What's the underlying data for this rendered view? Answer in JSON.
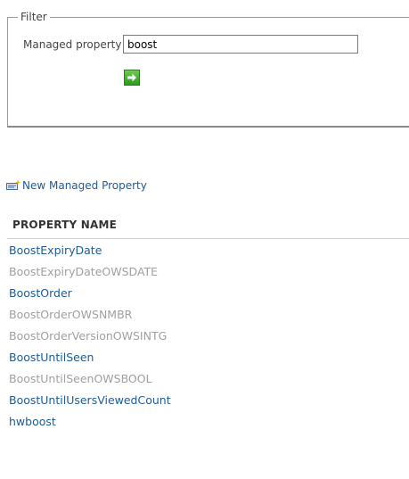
{
  "filter": {
    "legend": "Filter",
    "managed_property_label": "Managed property",
    "search_value": "boost",
    "go_icon": "green-arrow-right-icon"
  },
  "actions": {
    "new_property_label": "New Managed Property",
    "new_property_icon": "new-property-icon"
  },
  "table": {
    "header": "PROPERTY NAME",
    "rows": [
      {
        "name": "BoostExpiryDate",
        "state": "active"
      },
      {
        "name": "BoostExpiryDateOWSDATE",
        "state": "dim"
      },
      {
        "name": "BoostOrder",
        "state": "active"
      },
      {
        "name": "BoostOrderOWSNMBR",
        "state": "dim"
      },
      {
        "name": "BoostOrderVersionOWSINTG",
        "state": "dim"
      },
      {
        "name": "BoostUntilSeen",
        "state": "active"
      },
      {
        "name": "BoostUntilSeenOWSBOOL",
        "state": "dim"
      },
      {
        "name": "BoostUntilUsersViewedCount",
        "state": "active"
      },
      {
        "name": "hwboost",
        "state": "active"
      }
    ]
  },
  "colors": {
    "link": "#1e5b94",
    "dim_link": "#a0a0a0",
    "go_button": "#3aa52a"
  }
}
